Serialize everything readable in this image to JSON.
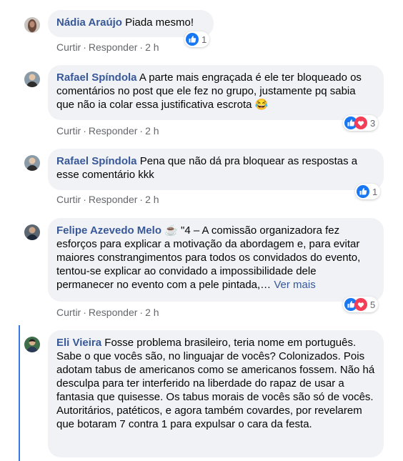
{
  "comments": [
    {
      "author": "Nádia Araújo",
      "text": "Piada mesmo!",
      "actions": {
        "like": "Curtir",
        "reply": "Responder",
        "time": "2 h"
      },
      "reactions": {
        "count": "1",
        "types": [
          "like"
        ]
      }
    },
    {
      "author": "Rafael Spíndola",
      "text": "A parte mais engraçada é ele ter bloqueado os comentários no post que ele fez no grupo, justamente pq sabia que não ia colar essa justificativa escrota",
      "emoji": "😂",
      "actions": {
        "like": "Curtir",
        "reply": "Responder",
        "time": "2 h"
      },
      "reactions": {
        "count": "3",
        "types": [
          "like",
          "love"
        ]
      }
    },
    {
      "author": "Rafael Spíndola",
      "text": "Pena que não dá pra bloquear as respostas a esse comentário kkk",
      "actions": {
        "like": "Curtir",
        "reply": "Responder",
        "time": "2 h"
      },
      "reactions": {
        "count": "1",
        "types": [
          "like"
        ]
      }
    },
    {
      "author": "Felipe Azevedo Melo",
      "author_emoji": "☕",
      "text": "\"4 – A comissão organizadora fez esforços para explicar a motivação da abordagem e, para evitar maiores constrangimentos para todos os convidados do evento, tentou-se explicar ao convidado a impossibilidade dele permanecer no evento com a pele pintada,…",
      "see_more": "Ver mais",
      "actions": {
        "like": "Curtir",
        "reply": "Responder",
        "time": "2 h"
      },
      "reactions": {
        "count": "5",
        "types": [
          "like",
          "love"
        ]
      }
    },
    {
      "author": "Eli Vieira",
      "text": "Fosse problema brasileiro, teria nome em português. Sabe o que vocês são, no linguajar de vocês? Colonizados. Pois adotam tabus de americanos como se americanos fossem. Não há desculpa para ter interferido na liberdade do rapaz de usar a fantasia que quisesse. Os tabus morais de vocês são só de vocês. Autoritários, patéticos, e agora também covardes, por revelarem que botaram 7 contra 1 para expulsar o cara da festa."
    }
  ],
  "colors": {
    "author": "#385898",
    "bubble": "#f0f2f5",
    "meta": "#65676b",
    "like": "#1877f2",
    "love": "#f33e58",
    "thread": "#3578e5"
  }
}
